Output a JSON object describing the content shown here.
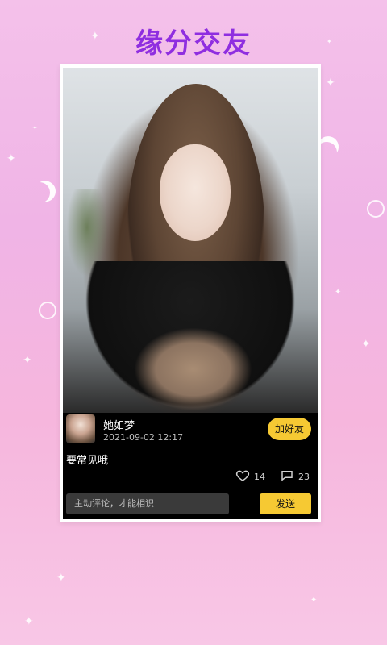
{
  "page": {
    "title": "缘分交友"
  },
  "post": {
    "username": "她如梦",
    "timestamp": "2021-09-02 12:17",
    "add_friend_label": "加好友",
    "text": "要常见哦",
    "likes": "14",
    "comments": "23"
  },
  "comment": {
    "placeholder": "主动评论，才能相识",
    "send_label": "发送"
  },
  "colors": {
    "title": "#8f2ee0",
    "accent": "#f6c933",
    "card_bg": "#000000"
  },
  "icons": {
    "like": "heart-icon",
    "comment": "comment-bubble-icon",
    "decor": [
      "sparkle-icon",
      "moon-icon",
      "bubble-icon"
    ]
  }
}
